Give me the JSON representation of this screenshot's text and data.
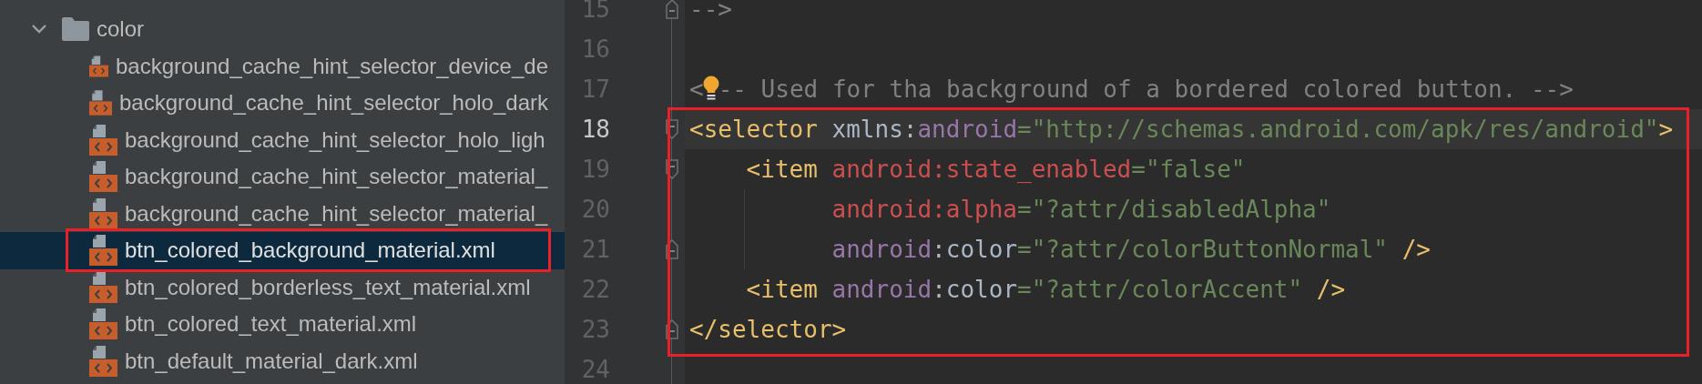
{
  "tree": {
    "folder": {
      "label": "color",
      "expanded": true
    },
    "files": [
      {
        "label": "background_cache_hint_selector_device_de",
        "selected": false,
        "annotated": false
      },
      {
        "label": "background_cache_hint_selector_holo_dark",
        "selected": false,
        "annotated": false
      },
      {
        "label": "background_cache_hint_selector_holo_ligh",
        "selected": false,
        "annotated": false
      },
      {
        "label": "background_cache_hint_selector_material_",
        "selected": false,
        "annotated": false
      },
      {
        "label": "background_cache_hint_selector_material_",
        "selected": false,
        "annotated": false
      },
      {
        "label": "btn_colored_background_material.xml",
        "selected": true,
        "annotated": true
      },
      {
        "label": "btn_colored_borderless_text_material.xml",
        "selected": false,
        "annotated": false
      },
      {
        "label": "btn_colored_text_material.xml",
        "selected": false,
        "annotated": false
      },
      {
        "label": "btn_default_material_dark.xml",
        "selected": false,
        "annotated": false
      }
    ]
  },
  "editor": {
    "lines": [
      {
        "number": "15",
        "current": false,
        "annotated": false,
        "fold_start": false,
        "fold_end": true,
        "indent_guide": false,
        "tokens": [
          {
            "kind": "comment",
            "text": "-->"
          }
        ]
      },
      {
        "number": "16",
        "current": false,
        "annotated": false,
        "fold_start": false,
        "fold_end": false,
        "indent_guide": false
      },
      {
        "number": "17",
        "current": false,
        "annotated": false,
        "fold_start": false,
        "fold_end": false,
        "indent_guide": false,
        "tokens": [
          {
            "kind": "comment",
            "text": "<"
          },
          {
            "kind": "bulb"
          },
          {
            "kind": "comment",
            "text": "-- Used for tha background of a bordered colored button. -->"
          }
        ]
      },
      {
        "number": "18",
        "current": true,
        "annotated": true,
        "fold_start": true,
        "fold_end": false,
        "indent_guide": false,
        "tokens": [
          {
            "kind": "tag",
            "text": "<selector"
          },
          {
            "kind": "plain",
            "text": " xmlns:"
          },
          {
            "kind": "ns",
            "text": "android"
          },
          {
            "kind": "value",
            "text": "=\"http://schemas.android.com/apk/res/android\""
          },
          {
            "kind": "tag",
            "text": ">"
          }
        ]
      },
      {
        "number": "19",
        "current": false,
        "annotated": true,
        "fold_start": true,
        "fold_end": false,
        "indent_guide": false,
        "tokens": [
          {
            "kind": "tag",
            "text": "    <item"
          },
          {
            "kind": "attr",
            "text": " android:state_enabled"
          },
          {
            "kind": "value",
            "text": "=\"false\""
          }
        ]
      },
      {
        "number": "20",
        "current": false,
        "annotated": true,
        "fold_start": false,
        "fold_end": false,
        "indent_guide": true,
        "tokens": [
          {
            "kind": "attr",
            "text": "          android:alpha"
          },
          {
            "kind": "value",
            "text": "=\"?attr/disabledAlpha\""
          }
        ]
      },
      {
        "number": "21",
        "current": false,
        "annotated": true,
        "fold_start": false,
        "fold_end": true,
        "indent_guide": true,
        "tokens": [
          {
            "kind": "ns",
            "text": "          android"
          },
          {
            "kind": "plain",
            "text": ":color"
          },
          {
            "kind": "value",
            "text": "=\"?attr/colorButtonNormal\""
          },
          {
            "kind": "tag",
            "text": " />"
          }
        ]
      },
      {
        "number": "22",
        "current": false,
        "annotated": true,
        "fold_start": false,
        "fold_end": false,
        "indent_guide": false,
        "tokens": [
          {
            "kind": "tag",
            "text": "    <item"
          },
          {
            "kind": "ns",
            "text": " android"
          },
          {
            "kind": "plain",
            "text": ":color"
          },
          {
            "kind": "value",
            "text": "=\"?attr/colorAccent\""
          },
          {
            "kind": "tag",
            "text": " />"
          }
        ]
      },
      {
        "number": "23",
        "current": false,
        "annotated": true,
        "fold_start": false,
        "fold_end": true,
        "indent_guide": false,
        "tokens": [
          {
            "kind": "tag",
            "text": "</selector>"
          }
        ]
      },
      {
        "number": "24",
        "current": false,
        "annotated": false,
        "fold_start": false,
        "fold_end": false,
        "indent_guide": false
      }
    ]
  }
}
